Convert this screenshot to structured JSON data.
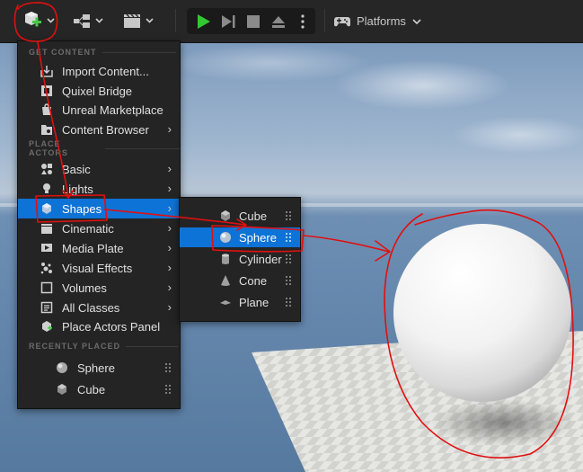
{
  "toolbar": {
    "platforms_label": "Platforms"
  },
  "menu": {
    "sections": {
      "get_content": "GET CONTENT",
      "place_actors": "PLACE ACTORS",
      "recently_placed": "RECENTLY PLACED"
    },
    "get_content_items": [
      {
        "label": "Import Content...",
        "icon": "import-icon"
      },
      {
        "label": "Quixel Bridge",
        "icon": "quixel-icon"
      },
      {
        "label": "Unreal Marketplace",
        "icon": "marketplace-icon"
      },
      {
        "label": "Content Browser",
        "icon": "content-browser-icon"
      }
    ],
    "place_actor_items": [
      {
        "label": "Basic",
        "icon": "basic-icon"
      },
      {
        "label": "Lights",
        "icon": "light-icon"
      },
      {
        "label": "Shapes",
        "icon": "shapes-icon"
      },
      {
        "label": "Cinematic",
        "icon": "cinematic-icon"
      },
      {
        "label": "Media Plate",
        "icon": "media-plate-icon"
      },
      {
        "label": "Visual Effects",
        "icon": "visual-effects-icon"
      },
      {
        "label": "Volumes",
        "icon": "volumes-icon"
      },
      {
        "label": "All Classes",
        "icon": "all-classes-icon"
      },
      {
        "label": "Place Actors Panel",
        "icon": "place-actors-panel-icon"
      }
    ],
    "recently_placed_items": [
      {
        "label": "Sphere",
        "icon": "sphere-icon"
      },
      {
        "label": "Cube",
        "icon": "cube-icon"
      }
    ]
  },
  "shapes_submenu": {
    "items": [
      {
        "label": "Cube",
        "icon": "cube-icon"
      },
      {
        "label": "Sphere",
        "icon": "sphere-icon"
      },
      {
        "label": "Cylinder",
        "icon": "cylinder-icon"
      },
      {
        "label": "Cone",
        "icon": "cone-icon"
      },
      {
        "label": "Plane",
        "icon": "plane-icon"
      }
    ]
  },
  "colors": {
    "selection": "#0e73d6",
    "play_green": "#32c832",
    "annotation_red": "#e01010",
    "add_plus_green": "#46c846"
  }
}
